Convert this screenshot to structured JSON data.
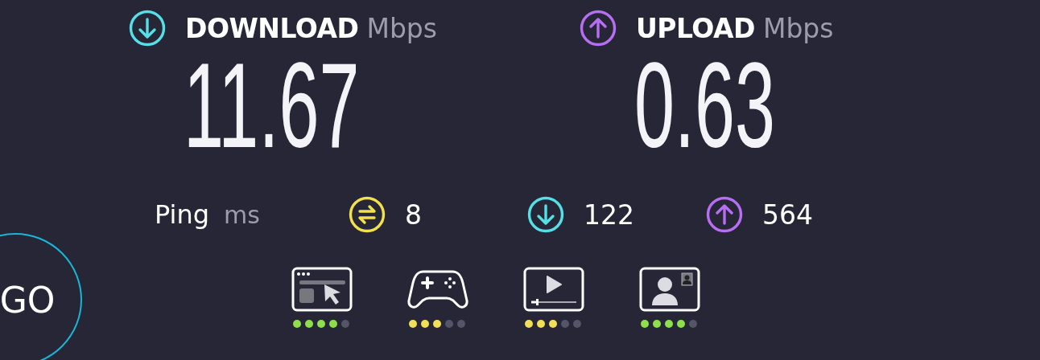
{
  "download": {
    "kind": "download",
    "label": "DOWNLOAD",
    "unit": "Mbps",
    "value": "11.67"
  },
  "upload": {
    "kind": "upload",
    "label": "UPLOAD",
    "unit": "Mbps",
    "value": "0.63"
  },
  "ping": {
    "label": "Ping",
    "unit": "ms",
    "items": [
      {
        "kind": "jitter",
        "value": "8"
      },
      {
        "kind": "download",
        "value": "122"
      },
      {
        "kind": "upload",
        "value": "564"
      }
    ]
  },
  "ratings": [
    {
      "kind": "browsing",
      "stars": 4,
      "color": "#8ee04a"
    },
    {
      "kind": "gaming",
      "stars": 3,
      "color": "#f3de5a"
    },
    {
      "kind": "streaming",
      "stars": 3,
      "color": "#f3de5a"
    },
    {
      "kind": "video_call",
      "stars": 4,
      "color": "#8ee04a"
    }
  ],
  "go_button": {
    "label": "GO"
  }
}
